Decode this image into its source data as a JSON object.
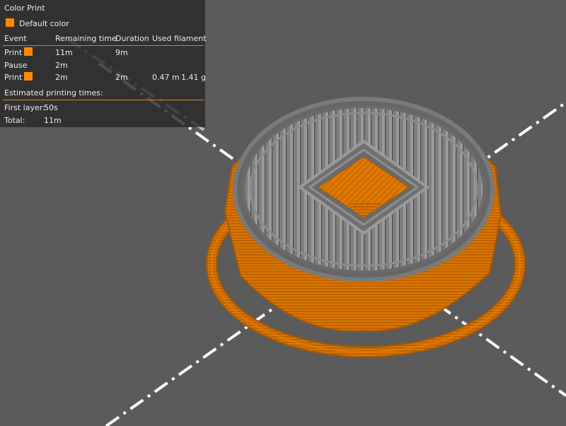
{
  "legend": {
    "title": "Color Print",
    "default_color_label": "Default color",
    "columns": [
      "Event",
      "Remaining time",
      "Duration",
      "Used filament"
    ],
    "rows": [
      {
        "event": "Print",
        "has_swatch": true,
        "remaining": "11m",
        "duration": "9m",
        "filament_m": "",
        "filament_g": ""
      },
      {
        "event": "Pause",
        "has_swatch": false,
        "remaining": "2m",
        "duration": "",
        "filament_m": "",
        "filament_g": ""
      },
      {
        "event": "Print",
        "has_swatch": true,
        "remaining": "2m",
        "duration": "2m",
        "filament_m": "0.47 m",
        "filament_g": "1.41 g"
      }
    ],
    "estimated_label": "Estimated printing times:",
    "first_layer_label": "First layer:",
    "first_layer_value": "50s",
    "total_label": "Total:",
    "total_value": "11m"
  },
  "colors": {
    "background": "#5b5b5b",
    "filament_orange": "#e07800",
    "swatch_orange": "#ff8a00",
    "perimeter_gray": "#8a8a8a",
    "axis_white": "#ffffff"
  },
  "icons": {
    "default_color_swatch": "orange-swatch-icon"
  }
}
